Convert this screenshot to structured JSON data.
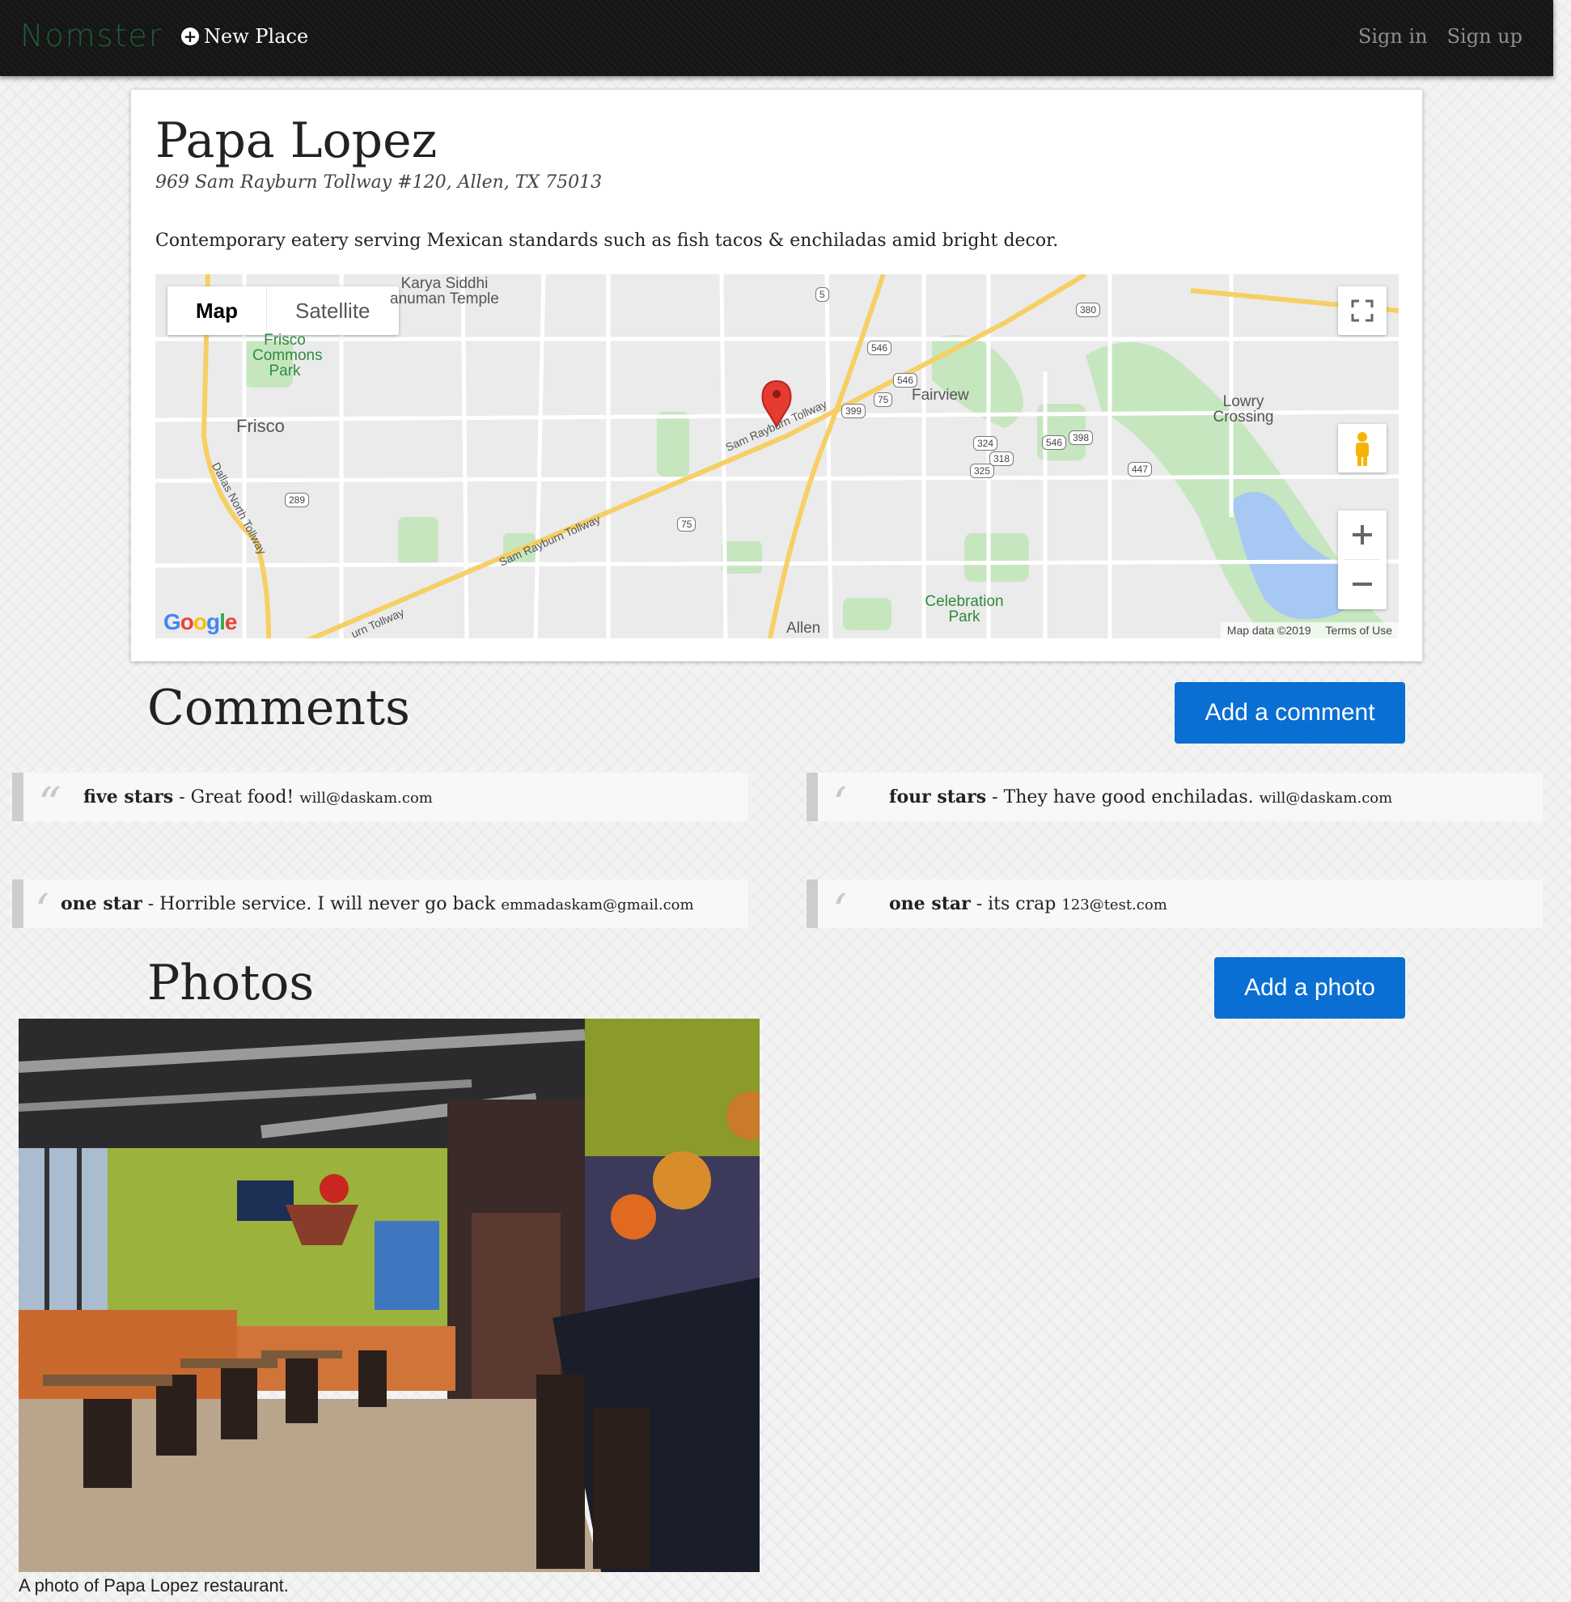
{
  "navbar": {
    "brand": "Nomster",
    "new_place": "New Place",
    "sign_in": "Sign in",
    "sign_up": "Sign up"
  },
  "place": {
    "name": "Papa Lopez",
    "address": "969 Sam Rayburn Tollway #120, Allen, TX 75013",
    "description": "Contemporary eatery serving Mexican standards such as fish tacos & enchiladas amid bright decor."
  },
  "map": {
    "type_map": "Map",
    "type_satellite": "Satellite",
    "labels": {
      "karya": "Karya Siddhi\nanuman Temple",
      "frisco_commons": "Frisco\nCommons\nPark",
      "frisco": "Frisco",
      "fairview": "Fairview",
      "lowry": "Lowry\nCrossing",
      "celebration": "Celebration\nPark",
      "allen": "Allen",
      "tollway_1": "Sam Rayburn Tollway",
      "tollway_2": "Sam Rayburn Tollway",
      "tollway_3": "urn Tollway",
      "dallas_north": "Dallas North Tollway"
    },
    "shields": [
      "5",
      "546",
      "546",
      "399",
      "75",
      "324",
      "318",
      "325",
      "546",
      "398",
      "447",
      "289",
      "75",
      "380"
    ],
    "logo": "Google",
    "attribution": "Map data ©2019",
    "terms": "Terms of Use"
  },
  "comments_section": {
    "title": "Comments",
    "add_button": "Add a comment",
    "items": [
      {
        "stars": "five stars",
        "sep": " - ",
        "body": "Great food!",
        "email": "will@daskam.com"
      },
      {
        "stars": "four stars",
        "sep": " - ",
        "body": "They have good enchiladas.",
        "email": "will@daskam.com"
      },
      {
        "stars": "one star",
        "sep": " - ",
        "body": "Horrible service. I will never go back",
        "email": "emmadaskam@gmail.com"
      },
      {
        "stars": "one star",
        "sep": " - ",
        "body": "its crap",
        "email": "123@test.com"
      }
    ]
  },
  "photos_section": {
    "title": "Photos",
    "add_button": "Add a photo",
    "caption": "A photo of Papa Lopez restaurant."
  },
  "colors": {
    "navbar_bg": "#151515",
    "brand": "#1f5c35",
    "button": "#0a6fd3",
    "comment_border": "#cdcdcd"
  },
  "icons": [
    "plus-circle-icon",
    "map-pin-icon",
    "fullscreen-icon",
    "pegman-icon",
    "zoom-in-icon",
    "zoom-out-icon",
    "quote-icon"
  ]
}
